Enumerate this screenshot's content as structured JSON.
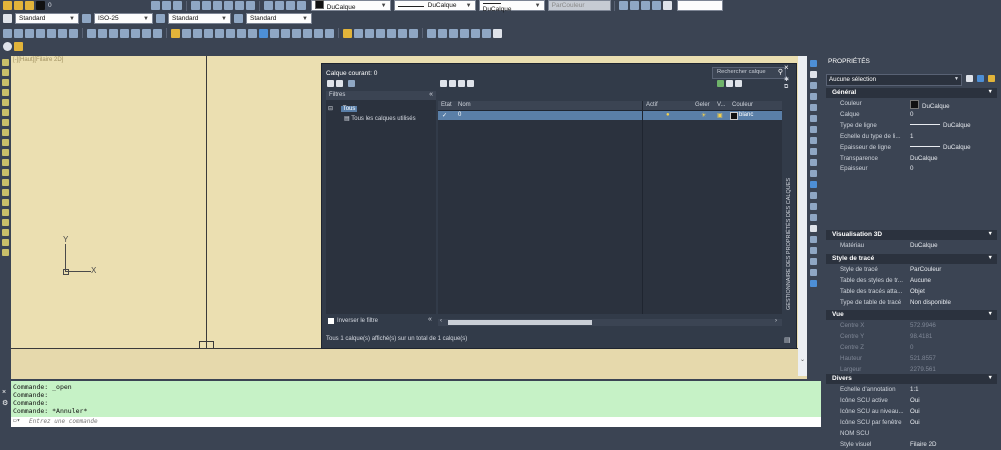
{
  "toolbar1": {
    "layer_value": "0",
    "color_value": "DuCalque",
    "linetype_value": "DuCalque",
    "lineweight_value": "DuCalque",
    "plotstyle_value": "ParCouleur"
  },
  "toolbar2": {
    "text_style": "Standard",
    "dim_style": "ISO-25",
    "table_style": "Standard",
    "mleader_style": "Standard"
  },
  "viewport_label": "[-][Haut][Filaire 2D]",
  "layer_manager": {
    "current_layer": "Calque courant: 0",
    "search_placeholder": "Rechercher calque",
    "filters_header": "Filtres",
    "filter_all": "Tous",
    "filter_used": "Tous les calques utilisés",
    "columns": [
      "Etat",
      "Nom",
      "Actif",
      "Geler",
      "V...",
      "Couleur"
    ],
    "layer_row": {
      "name": "0",
      "color": "blanc"
    },
    "invert_filter": "Inverser le filtre",
    "status": "Tous 1 calque(s) affiché(s) sur un total de 1 calque(s)",
    "side_title": "GESTIONNAIRE DES PROPRIÉTÉS DES CALQUES"
  },
  "ucs": {
    "x": "X",
    "y": "Y"
  },
  "properties": {
    "title": "PROPRIÉTÉS",
    "selection": "Aucune sélection",
    "sections": {
      "general": "Général",
      "vis3d": "Visualisation 3D",
      "plotstyle": "Style de tracé",
      "view": "Vue",
      "misc": "Divers"
    },
    "general": [
      {
        "k": "Couleur",
        "v": "DuCalque"
      },
      {
        "k": "Calque",
        "v": "0"
      },
      {
        "k": "Type de ligne",
        "v": "DuCalque"
      },
      {
        "k": "Echelle du type de li...",
        "v": "1"
      },
      {
        "k": "Epaisseur de ligne",
        "v": "DuCalque"
      },
      {
        "k": "Transparence",
        "v": "DuCalque"
      },
      {
        "k": "Epaisseur",
        "v": "0"
      }
    ],
    "vis3d": [
      {
        "k": "Matériau",
        "v": "DuCalque"
      }
    ],
    "plotstyle": [
      {
        "k": "Style de tracé",
        "v": "ParCouleur"
      },
      {
        "k": "Table des styles de tr...",
        "v": "Aucune"
      },
      {
        "k": "Table des tracés atta...",
        "v": "Objet"
      },
      {
        "k": "Type de table de tracé",
        "v": "Non disponible"
      }
    ],
    "view": [
      {
        "k": "Centre X",
        "v": "572.9946"
      },
      {
        "k": "Centre Y",
        "v": "98.4181"
      },
      {
        "k": "Centre Z",
        "v": "0"
      },
      {
        "k": "Hauteur",
        "v": "521.8557"
      },
      {
        "k": "Largeur",
        "v": "2279.561"
      }
    ],
    "misc": [
      {
        "k": "Echelle d'annotation",
        "v": "1:1"
      },
      {
        "k": "Icône SCU active",
        "v": "Oui"
      },
      {
        "k": "Icône SCU au niveau...",
        "v": "Oui"
      },
      {
        "k": "Icône SCU par fenêtre",
        "v": "Oui"
      },
      {
        "k": "NOM SCU",
        "v": ""
      },
      {
        "k": "Style visuel",
        "v": "Filaire 2D"
      }
    ]
  },
  "command": {
    "history": [
      "Commande: _open",
      "Commande:",
      "Commande:",
      "Commande: *Annuler*"
    ],
    "placeholder": "Entrez une commande"
  }
}
